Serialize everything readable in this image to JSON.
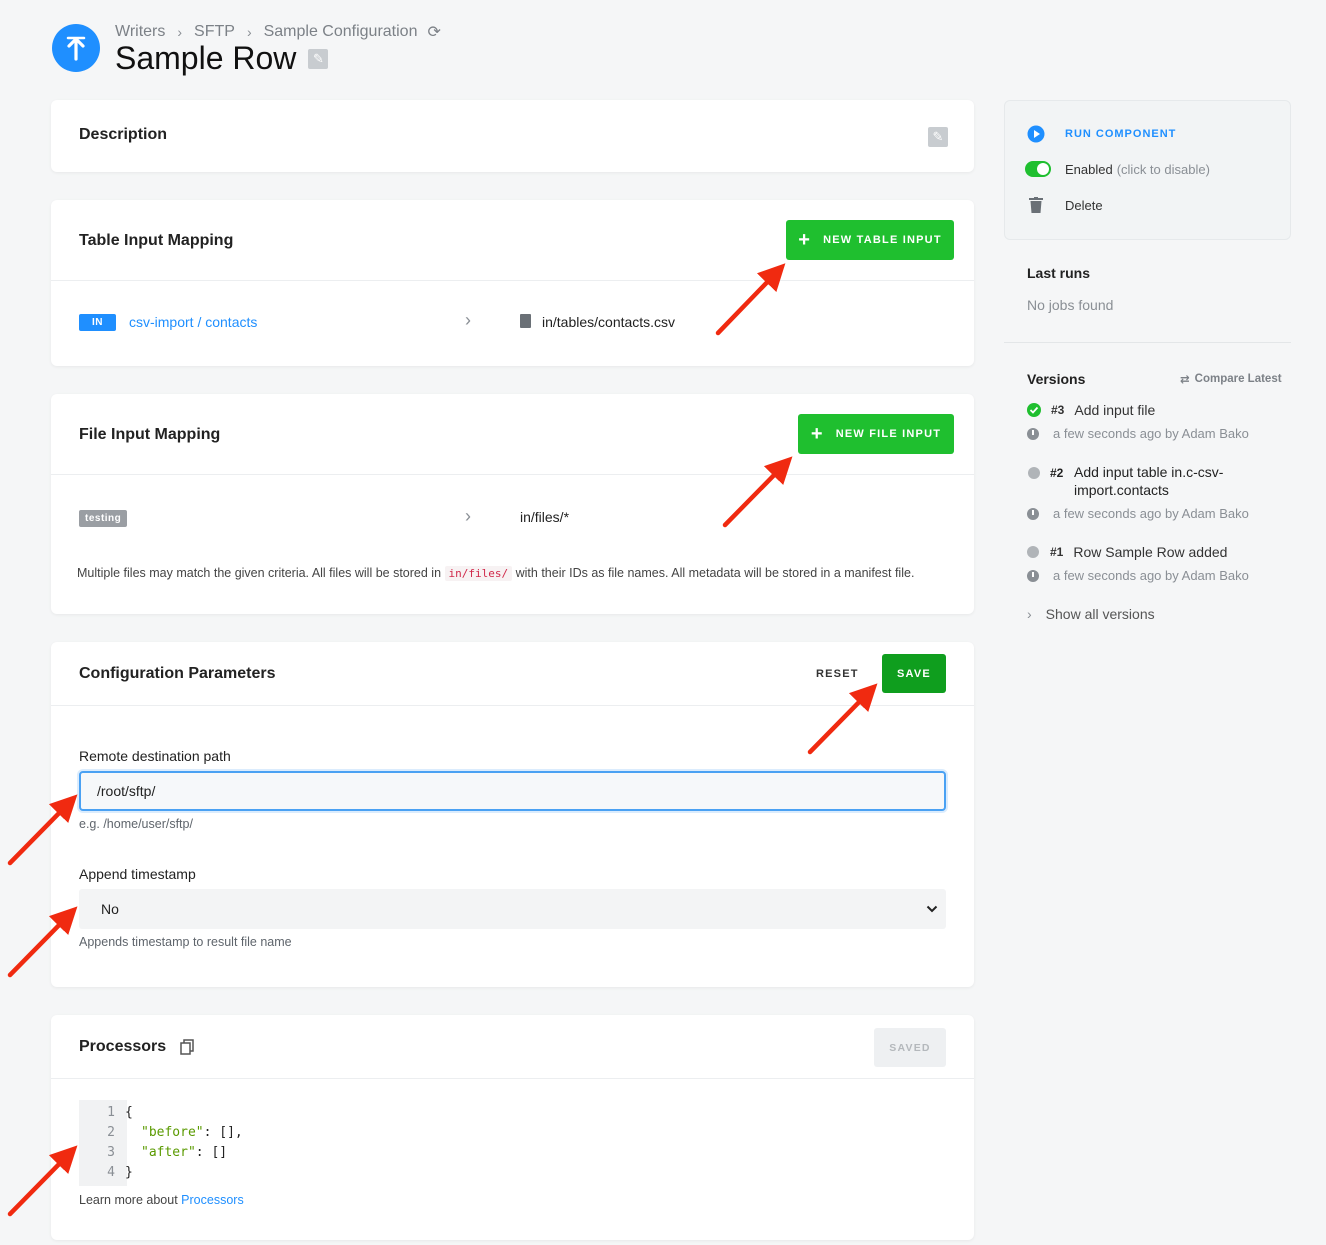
{
  "header": {
    "breadcrumbs": [
      "Writers",
      "SFTP",
      "Sample Configuration"
    ],
    "title": "Sample Row"
  },
  "description": {
    "title": "Description"
  },
  "table_input": {
    "title": "Table Input Mapping",
    "button": "NEW TABLE INPUT",
    "rows": [
      {
        "badge": "IN",
        "source": "csv-import / contacts",
        "destination": "in/tables/contacts.csv"
      }
    ]
  },
  "file_input": {
    "title": "File Input Mapping",
    "button": "NEW FILE INPUT",
    "rows": [
      {
        "tag": "testing",
        "destination": "in/files/*"
      }
    ],
    "note_pre": "Multiple files may match the given criteria. All files will be stored in",
    "note_code": "in/files/",
    "note_post": "with their IDs as file names. All metadata will be stored in a manifest file."
  },
  "config": {
    "title": "Configuration Parameters",
    "reset_label": "RESET",
    "save_label": "SAVE",
    "path_label": "Remote destination path",
    "path_value": "/root/sftp/",
    "path_help": "e.g. /home/user/sftp/",
    "timestamp_label": "Append timestamp",
    "timestamp_value": "No",
    "timestamp_help": "Appends timestamp to result file name"
  },
  "processors": {
    "title": "Processors",
    "saved_label": "SAVED",
    "code": [
      {
        "n": "1",
        "text": "{"
      },
      {
        "n": "2",
        "key": "\"before\"",
        "rest": ": [],"
      },
      {
        "n": "3",
        "key": "\"after\"",
        "rest": ": []"
      },
      {
        "n": "4",
        "text": "}"
      }
    ],
    "learn_pre": "Learn more about",
    "learn_link": "Processors"
  },
  "sidebar": {
    "run_label": "RUN COMPONENT",
    "enabled_label": "Enabled",
    "enabled_hint": "(click to disable)",
    "delete_label": "Delete",
    "last_runs_title": "Last runs",
    "last_runs_empty": "No jobs found",
    "versions_title": "Versions",
    "compare_label": "Compare Latest",
    "versions": [
      {
        "num": "#3",
        "title": "Add input file",
        "meta": "a few seconds ago by Adam Bako",
        "status": "current"
      },
      {
        "num": "#2",
        "title_line1": "Add input table in.c-csv-",
        "title_line2": "import.contacts",
        "meta": "a few seconds ago by Adam Bako",
        "status": "old"
      },
      {
        "num": "#1",
        "title": "Row Sample Row added",
        "meta": "a few seconds ago by Adam Bako",
        "status": "old"
      }
    ],
    "show_all_label": "Show all versions"
  },
  "colors": {
    "accent": "#1f8fff",
    "green": "#1fbf2f",
    "save_green": "#0f9e1e",
    "annotation_red": "#f02a10"
  }
}
